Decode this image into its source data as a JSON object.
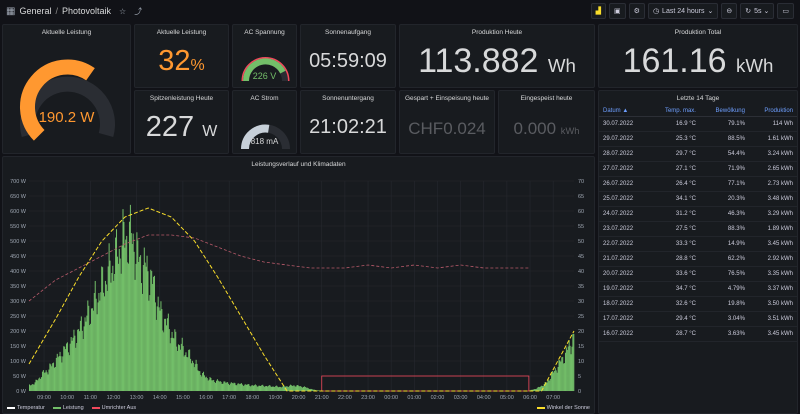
{
  "topbar": {
    "folder": "General",
    "separator": "/",
    "dashboard": "Photovoltaik",
    "time_range": "Last 24 hours",
    "refresh": "5s"
  },
  "panels": {
    "aktuelle_leistung_gauge": {
      "title": "Aktuelle Leistung",
      "value": "190.2 W",
      "fill": 0.63
    },
    "aktuelle_leistung_pct": {
      "title": "Aktuelle Leistung",
      "value": "32",
      "unit": "%"
    },
    "ac_spannung": {
      "title": "AC Spannung",
      "value": "226 V",
      "fill": 0.85
    },
    "sonnenaufgang": {
      "title": "Sonnenaufgang",
      "value": "05:59:09"
    },
    "produktion_heute": {
      "title": "Produktion Heute",
      "value": "113.882",
      "unit": "Wh"
    },
    "produktion_total": {
      "title": "Produktion Total",
      "value": "161.16",
      "unit": "kWh"
    },
    "spitzenleistung": {
      "title": "Spitzenleistung Heute",
      "value": "227",
      "unit": "W"
    },
    "ac_strom": {
      "title": "AC Strom",
      "value": "818 mA",
      "fill": 0.55
    },
    "sonnenuntergang": {
      "title": "Sonnenuntergang",
      "value": "21:02:21"
    },
    "gespart": {
      "title": "Gespart + Einspeisung heute",
      "value": "CHF0.024"
    },
    "eingespeist": {
      "title": "Eingespeist heute",
      "value": "0.000",
      "unit": "kWh"
    }
  },
  "table14": {
    "title": "Letzte 14 Tage",
    "headers": [
      "Datum ▲",
      "Temp. max.",
      "Bewölkung",
      "Produktion"
    ],
    "rows": [
      [
        "30.07.2022",
        "16.9 °C",
        "79.1%",
        "114 Wh"
      ],
      [
        "29.07.2022",
        "25.3 °C",
        "88.5%",
        "1.61 kWh"
      ],
      [
        "28.07.2022",
        "29.7 °C",
        "54.4%",
        "3.24 kWh"
      ],
      [
        "27.07.2022",
        "27.1 °C",
        "71.9%",
        "2.65 kWh"
      ],
      [
        "26.07.2022",
        "26.4 °C",
        "77.1%",
        "2.73 kWh"
      ],
      [
        "25.07.2022",
        "34.1 °C",
        "20.3%",
        "3.48 kWh"
      ],
      [
        "24.07.2022",
        "31.2 °C",
        "46.3%",
        "3.29 kWh"
      ],
      [
        "23.07.2022",
        "27.5 °C",
        "88.3%",
        "1.89 kWh"
      ],
      [
        "22.07.2022",
        "33.3 °C",
        "14.9%",
        "3.45 kWh"
      ],
      [
        "21.07.2022",
        "28.8 °C",
        "62.2%",
        "2.92 kWh"
      ],
      [
        "20.07.2022",
        "33.6 °C",
        "76.5%",
        "3.35 kWh"
      ],
      [
        "19.07.2022",
        "34.7 °C",
        "4.79%",
        "3.37 kWh"
      ],
      [
        "18.07.2022",
        "32.6 °C",
        "19.8%",
        "3.50 kWh"
      ],
      [
        "17.07.2022",
        "29.4 °C",
        "3.04%",
        "3.51 kWh"
      ],
      [
        "16.07.2022",
        "28.7 °C",
        "3.63%",
        "3.45 kWh"
      ]
    ]
  },
  "chart_data": {
    "type": "area",
    "title": "Leistungsverlauf und Klimadaten",
    "y_left_ticks": [
      "0 W",
      "50 W",
      "100 W",
      "150 W",
      "200 W",
      "250 W",
      "300 W",
      "350 W",
      "400 W",
      "450 W",
      "500 W",
      "550 W",
      "600 W",
      "650 W",
      "700 W"
    ],
    "y_right_ticks": [
      "0",
      "5",
      "10",
      "15",
      "20",
      "25",
      "30",
      "35",
      "40",
      "45",
      "50",
      "55",
      "60",
      "65",
      "70"
    ],
    "x_ticks": [
      "09:00",
      "10:00",
      "11:00",
      "12:00",
      "13:00",
      "14:00",
      "15:00",
      "16:00",
      "17:00",
      "18:00",
      "19:00",
      "20:00",
      "21:00",
      "22:00",
      "23:00",
      "00:00",
      "01:00",
      "02:00",
      "03:00",
      "04:00",
      "05:00",
      "06:00",
      "07:00"
    ],
    "ylim": [
      0,
      700
    ],
    "x_range_hours": [
      8.35,
      31.9
    ],
    "series": [
      {
        "name": "Temperatur",
        "color": "#ffffff"
      },
      {
        "name": "Leistung",
        "color": "#73bf69"
      },
      {
        "name": "Umrichter Aus",
        "color": "#f2495c"
      },
      {
        "name": "Winkel der Sonne",
        "color": "#fade2a"
      }
    ],
    "leistung_profile": [
      [
        8.35,
        20
      ],
      [
        8.6,
        30
      ],
      [
        8.9,
        60
      ],
      [
        9.2,
        80
      ],
      [
        9.5,
        110
      ],
      [
        9.8,
        140
      ],
      [
        10.2,
        180
      ],
      [
        10.6,
        230
      ],
      [
        11.0,
        290
      ],
      [
        11.4,
        360
      ],
      [
        11.8,
        430
      ],
      [
        12.1,
        480
      ],
      [
        12.4,
        540
      ],
      [
        12.7,
        560
      ],
      [
        12.9,
        520
      ],
      [
        13.1,
        460
      ],
      [
        13.4,
        440
      ],
      [
        13.7,
        380
      ],
      [
        14.0,
        280
      ],
      [
        14.3,
        240
      ],
      [
        14.6,
        190
      ],
      [
        15.0,
        150
      ],
      [
        15.4,
        110
      ],
      [
        15.8,
        60
      ],
      [
        16.2,
        40
      ],
      [
        16.8,
        30
      ],
      [
        17.4,
        25
      ],
      [
        18.0,
        20
      ],
      [
        18.6,
        18
      ],
      [
        19.2,
        15
      ],
      [
        19.8,
        20
      ],
      [
        20.2,
        15
      ],
      [
        20.6,
        5
      ],
      [
        21.0,
        0
      ],
      [
        29.9,
        0
      ],
      [
        30.3,
        10
      ],
      [
        30.7,
        30
      ],
      [
        31.1,
        80
      ],
      [
        31.5,
        130
      ],
      [
        31.9,
        200
      ]
    ],
    "temperature_profile": [
      [
        8.35,
        30
      ],
      [
        9.5,
        37
      ],
      [
        10.5,
        41
      ],
      [
        11.5,
        45
      ],
      [
        12.5,
        49
      ],
      [
        13.5,
        52
      ],
      [
        14.5,
        52
      ],
      [
        15.5,
        51
      ],
      [
        16.5,
        48
      ],
      [
        17.5,
        45
      ],
      [
        18.5,
        43
      ],
      [
        19.5,
        42
      ],
      [
        20.5,
        41
      ],
      [
        22,
        41
      ],
      [
        23,
        42
      ],
      [
        24,
        41
      ],
      [
        25,
        42
      ],
      [
        26,
        41
      ],
      [
        27,
        42
      ],
      [
        28,
        41
      ],
      [
        29,
        41
      ],
      [
        30,
        41
      ]
    ],
    "sun_angle_profile": [
      [
        8.35,
        9
      ],
      [
        9.5,
        24
      ],
      [
        10.5,
        38
      ],
      [
        11.5,
        50
      ],
      [
        12.5,
        58
      ],
      [
        13.5,
        61
      ],
      [
        14.5,
        58
      ],
      [
        15.5,
        50
      ],
      [
        16.5,
        38
      ],
      [
        17.5,
        25
      ],
      [
        18.5,
        12
      ],
      [
        19.5,
        0
      ],
      [
        20.5,
        -10
      ],
      [
        29.9,
        -10
      ],
      [
        30.5,
        0
      ],
      [
        31.2,
        10
      ],
      [
        31.9,
        20
      ]
    ]
  }
}
